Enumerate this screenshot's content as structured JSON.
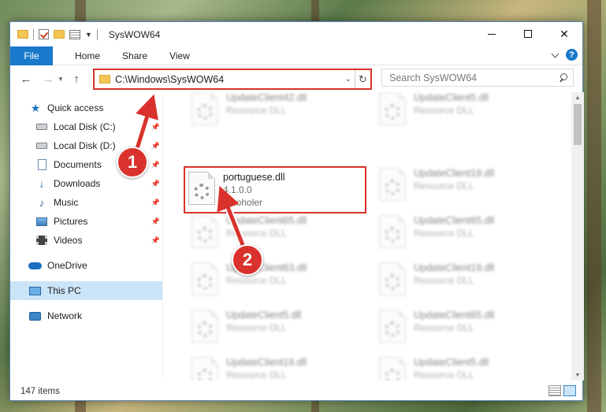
{
  "window": {
    "title": "SysWOW64"
  },
  "ribbon": {
    "tabs": [
      "File",
      "Home",
      "Share",
      "View"
    ],
    "help_label": "?"
  },
  "nav": {
    "address": "C:\\Windows\\SysWOW64",
    "search_placeholder": "Search SysWOW64"
  },
  "sidebar": {
    "items": [
      {
        "label": "Quick access",
        "icon": "star-icon"
      },
      {
        "label": "Local Disk (C:)",
        "icon": "disk-icon"
      },
      {
        "label": "Local Disk (D:)",
        "icon": "disk-icon"
      },
      {
        "label": "Documents",
        "icon": "document-icon"
      },
      {
        "label": "Downloads",
        "icon": "download-icon"
      },
      {
        "label": "Music",
        "icon": "music-icon"
      },
      {
        "label": "Pictures",
        "icon": "pictures-icon"
      },
      {
        "label": "Videos",
        "icon": "video-icon"
      },
      {
        "label": "OneDrive",
        "icon": "cloud-icon"
      },
      {
        "label": "This PC",
        "icon": "computer-icon"
      },
      {
        "label": "Network",
        "icon": "network-icon"
      }
    ],
    "selected": "This PC"
  },
  "files": {
    "highlighted": {
      "name": "portuguese.dll",
      "version": "4.1.0.0",
      "company": "Alcoholer"
    },
    "col1": [
      {
        "name": "UpdateClient42.dll",
        "type": "Resource DLL"
      },
      {
        "name": "UpdateClient65.dll",
        "type": "Resource DLL"
      },
      {
        "name": "UpdateClient63.dll",
        "type": "Resource DLL"
      },
      {
        "name": "UpdateClient5.dll",
        "type": "Resource DLL"
      },
      {
        "name": "UpdateClient19.dll",
        "type": "Resource DLL"
      }
    ],
    "col2": [
      {
        "name": "UpdateClient5.dll",
        "type": "Resource DLL"
      },
      {
        "name": "UpdateClient19.dll",
        "type": "Resource DLL"
      },
      {
        "name": "UpdateClient65.dll",
        "type": "Resource DLL"
      },
      {
        "name": "UpdateClient19.dll",
        "type": "Resource DLL"
      },
      {
        "name": "UpdateClient65.dll",
        "type": "Resource DLL"
      },
      {
        "name": "UpdateClient5.dll",
        "type": "Resource DLL"
      }
    ]
  },
  "status": {
    "item_count": "147 items"
  },
  "annotations": {
    "step1": "1",
    "step2": "2",
    "highlight_color": "#d9322c"
  }
}
